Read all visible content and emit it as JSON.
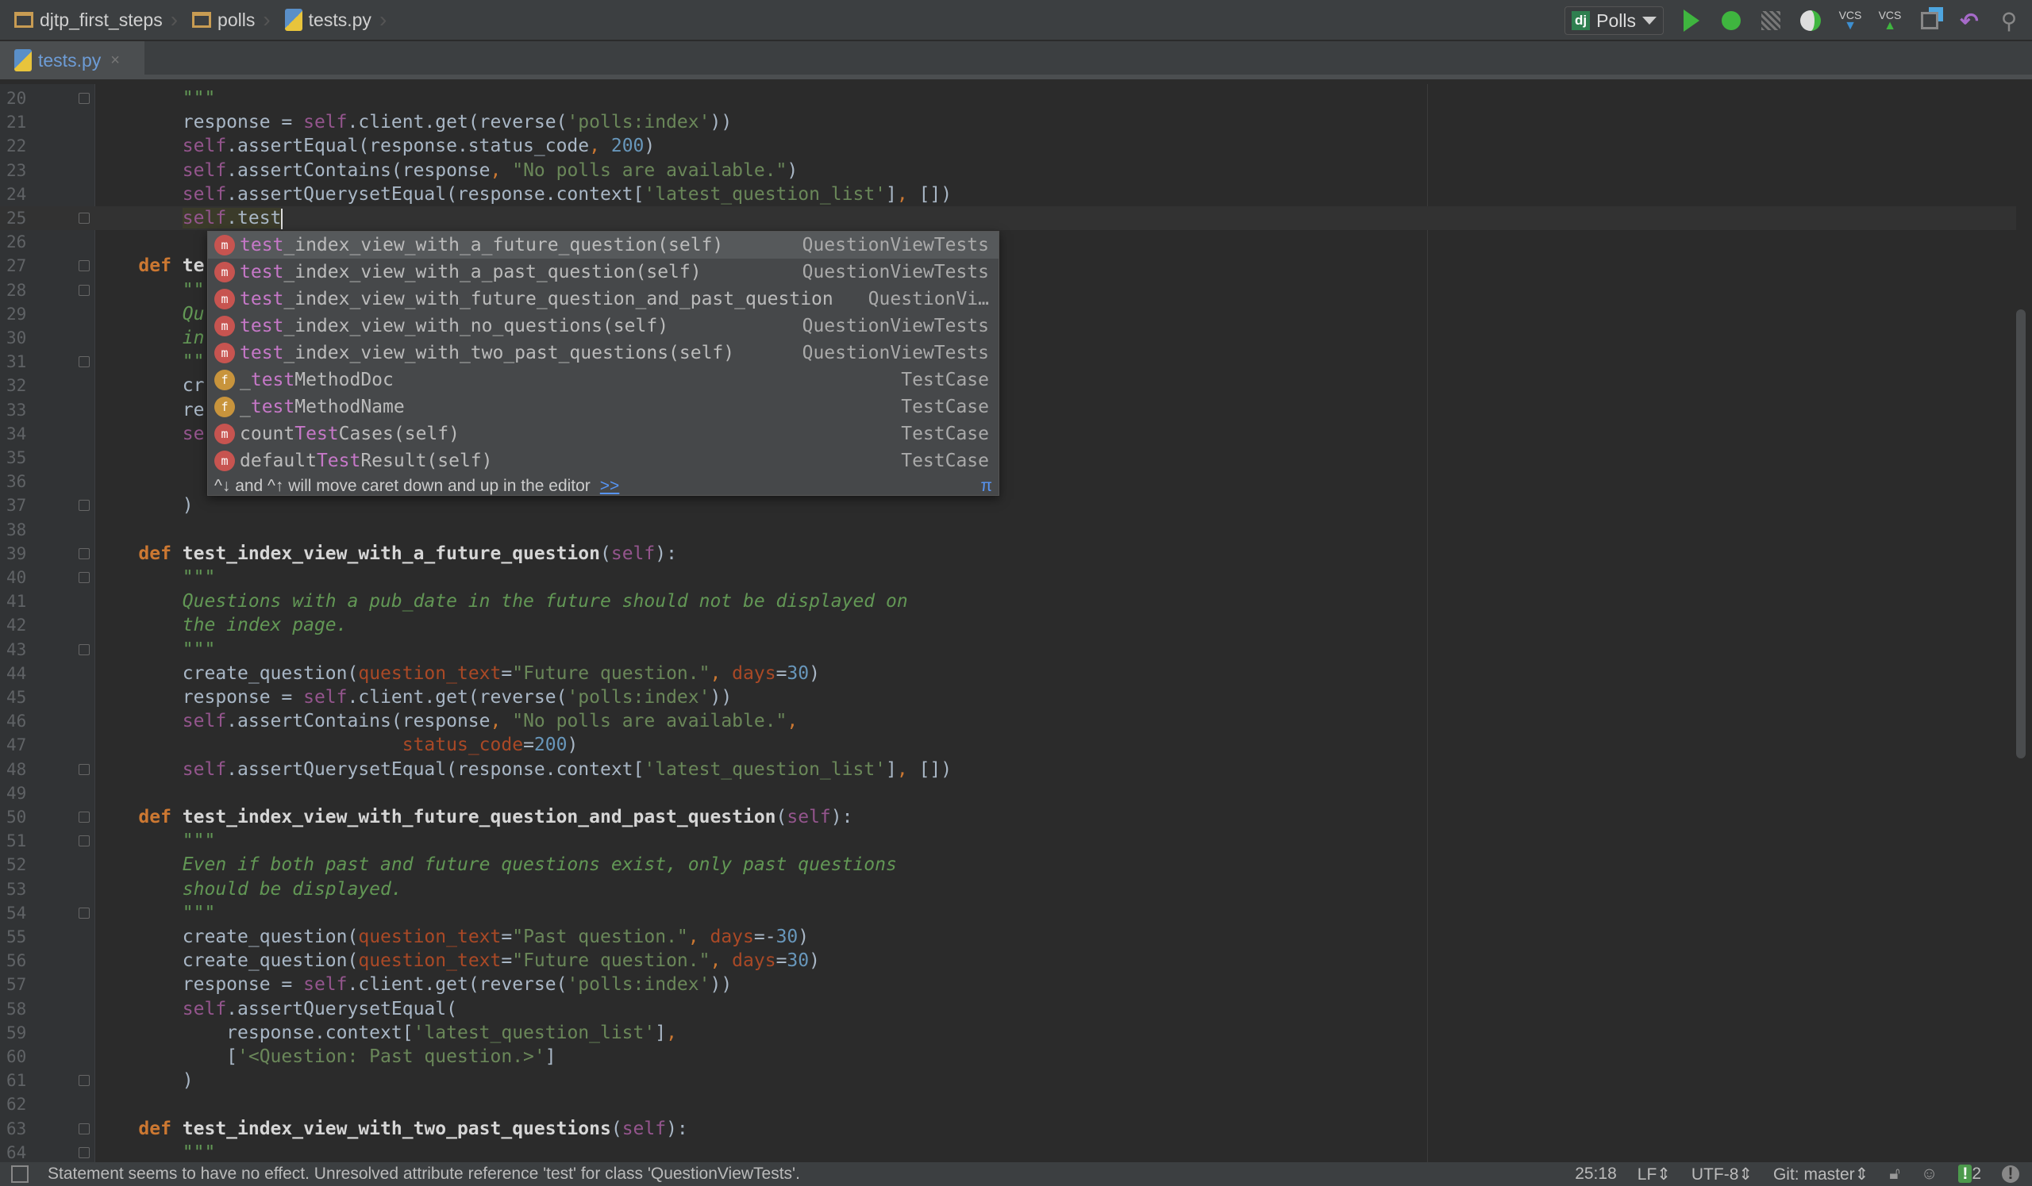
{
  "breadcrumb": [
    "djtp_first_steps",
    "polls",
    "tests.py"
  ],
  "run_config": {
    "label": "Polls",
    "badge": "dj"
  },
  "toolbar": {
    "vcs_update": "VCS",
    "vcs_commit": "VCS",
    "icons": [
      "run-icon",
      "debug-icon",
      "coverage-icon",
      "profile-icon",
      "vcs-update-icon",
      "vcs-commit-icon",
      "history-icon",
      "revert-icon",
      "search-icon"
    ]
  },
  "tab": {
    "label": "tests.py",
    "close": "×"
  },
  "colors": {
    "background": "#2b2b2b",
    "keyword": "#cc7832",
    "self": "#94558d",
    "string": "#6a8759",
    "number": "#6897bb",
    "docstring": "#629755",
    "kwarg": "#aa4926"
  },
  "code_lines": [
    {
      "n": "20",
      "t": [
        [
          "dq",
          "        \"\"\""
        ]
      ]
    },
    {
      "n": "21",
      "t": [
        [
          "p",
          "        response = "
        ],
        [
          "s",
          "self"
        ],
        [
          "p",
          ".client.get(reverse("
        ],
        [
          "str",
          "'polls:index'"
        ],
        [
          "p",
          "))"
        ]
      ]
    },
    {
      "n": "22",
      "t": [
        [
          "s",
          "        self"
        ],
        [
          "p",
          ".assertEqual(response.status_code"
        ],
        [
          "c",
          ", "
        ],
        [
          "n",
          "200"
        ],
        [
          "p",
          ")"
        ]
      ]
    },
    {
      "n": "23",
      "t": [
        [
          "s",
          "        self"
        ],
        [
          "p",
          ".assertContains(response"
        ],
        [
          "c",
          ", "
        ],
        [
          "str",
          "\"No polls are available.\""
        ],
        [
          "p",
          ")"
        ]
      ]
    },
    {
      "n": "24",
      "t": [
        [
          "s",
          "        self"
        ],
        [
          "p",
          ".assertQuerysetEqual(response.context["
        ],
        [
          "str",
          "'latest_question_list'"
        ],
        [
          "p",
          "]"
        ],
        [
          "c",
          ", "
        ],
        [
          "p",
          "[])"
        ]
      ]
    },
    {
      "n": "25",
      "t": [
        [
          "p",
          "        "
        ],
        [
          "s hl",
          "self"
        ],
        [
          "p hl",
          ".test"
        ]
      ],
      "cur": true
    },
    {
      "n": "26",
      "t": []
    },
    {
      "n": "27",
      "t": [
        [
          "k",
          "    def "
        ],
        [
          "fn",
          "te"
        ]
      ]
    },
    {
      "n": "28",
      "t": [
        [
          "dq",
          "        \"\"\""
        ]
      ]
    },
    {
      "n": "29",
      "t": [
        [
          "d",
          "        Qu"
        ]
      ]
    },
    {
      "n": "30",
      "t": [
        [
          "d",
          "        in"
        ]
      ]
    },
    {
      "n": "31",
      "t": [
        [
          "dq",
          "        \"\"\""
        ]
      ]
    },
    {
      "n": "32",
      "t": [
        [
          "p",
          "        cr"
        ]
      ]
    },
    {
      "n": "33",
      "t": [
        [
          "p",
          "        re"
        ]
      ]
    },
    {
      "n": "34",
      "t": [
        [
          "s",
          "        se"
        ]
      ]
    },
    {
      "n": "35",
      "t": []
    },
    {
      "n": "36",
      "t": []
    },
    {
      "n": "37",
      "t": [
        [
          "p",
          "        )"
        ]
      ]
    },
    {
      "n": "38",
      "t": []
    },
    {
      "n": "39",
      "t": [
        [
          "k",
          "    def "
        ],
        [
          "fn",
          "test_index_view_with_a_future_question"
        ],
        [
          "p",
          "("
        ],
        [
          "s",
          "self"
        ],
        [
          "p",
          "):"
        ]
      ]
    },
    {
      "n": "40",
      "t": [
        [
          "dq",
          "        \"\"\""
        ]
      ]
    },
    {
      "n": "41",
      "t": [
        [
          "d",
          "        Questions with a pub_date in the future should not be displayed on"
        ]
      ]
    },
    {
      "n": "42",
      "t": [
        [
          "d",
          "        the index page."
        ]
      ]
    },
    {
      "n": "43",
      "t": [
        [
          "dq",
          "        \"\"\""
        ]
      ]
    },
    {
      "n": "44",
      "t": [
        [
          "p",
          "        create_question("
        ],
        [
          "kw",
          "question_text"
        ],
        [
          "p",
          "="
        ],
        [
          "str",
          "\"Future question.\""
        ],
        [
          "c",
          ", "
        ],
        [
          "kw",
          "days"
        ],
        [
          "p",
          "="
        ],
        [
          "n",
          "30"
        ],
        [
          "p",
          ")"
        ]
      ]
    },
    {
      "n": "45",
      "t": [
        [
          "p",
          "        response = "
        ],
        [
          "s",
          "self"
        ],
        [
          "p",
          ".client.get(reverse("
        ],
        [
          "str",
          "'polls:index'"
        ],
        [
          "p",
          "))"
        ]
      ]
    },
    {
      "n": "46",
      "t": [
        [
          "s",
          "        self"
        ],
        [
          "p",
          ".assertContains(response"
        ],
        [
          "c",
          ", "
        ],
        [
          "str",
          "\"No polls are available.\""
        ],
        [
          "c",
          ","
        ]
      ]
    },
    {
      "n": "47",
      "t": [
        [
          "p",
          "                            "
        ],
        [
          "kw",
          "status_code"
        ],
        [
          "p",
          "="
        ],
        [
          "n",
          "200"
        ],
        [
          "p",
          ")"
        ]
      ]
    },
    {
      "n": "48",
      "t": [
        [
          "s",
          "        self"
        ],
        [
          "p",
          ".assertQuerysetEqual(response.context["
        ],
        [
          "str",
          "'latest_question_list'"
        ],
        [
          "p",
          "]"
        ],
        [
          "c",
          ", "
        ],
        [
          "p",
          "[])"
        ]
      ]
    },
    {
      "n": "49",
      "t": []
    },
    {
      "n": "50",
      "t": [
        [
          "k",
          "    def "
        ],
        [
          "fn",
          "test_index_view_with_future_question_and_past_question"
        ],
        [
          "p",
          "("
        ],
        [
          "s",
          "self"
        ],
        [
          "p",
          "):"
        ]
      ]
    },
    {
      "n": "51",
      "t": [
        [
          "dq",
          "        \"\"\""
        ]
      ]
    },
    {
      "n": "52",
      "t": [
        [
          "d",
          "        Even if both past and future questions exist, only past questions"
        ]
      ]
    },
    {
      "n": "53",
      "t": [
        [
          "d",
          "        should be displayed."
        ]
      ]
    },
    {
      "n": "54",
      "t": [
        [
          "dq",
          "        \"\"\""
        ]
      ]
    },
    {
      "n": "55",
      "t": [
        [
          "p",
          "        create_question("
        ],
        [
          "kw",
          "question_text"
        ],
        [
          "p",
          "="
        ],
        [
          "str",
          "\"Past question.\""
        ],
        [
          "c",
          ", "
        ],
        [
          "kw",
          "days"
        ],
        [
          "p",
          "=-"
        ],
        [
          "n",
          "30"
        ],
        [
          "p",
          ")"
        ]
      ]
    },
    {
      "n": "56",
      "t": [
        [
          "p",
          "        create_question("
        ],
        [
          "kw",
          "question_text"
        ],
        [
          "p",
          "="
        ],
        [
          "str",
          "\"Future question.\""
        ],
        [
          "c",
          ", "
        ],
        [
          "kw",
          "days"
        ],
        [
          "p",
          "="
        ],
        [
          "n",
          "30"
        ],
        [
          "p",
          ")"
        ]
      ]
    },
    {
      "n": "57",
      "t": [
        [
          "p",
          "        response = "
        ],
        [
          "s",
          "self"
        ],
        [
          "p",
          ".client.get(reverse("
        ],
        [
          "str",
          "'polls:index'"
        ],
        [
          "p",
          "))"
        ]
      ]
    },
    {
      "n": "58",
      "t": [
        [
          "s",
          "        self"
        ],
        [
          "p",
          ".assertQuerysetEqual("
        ]
      ]
    },
    {
      "n": "59",
      "t": [
        [
          "p",
          "            response.context["
        ],
        [
          "str",
          "'latest_question_list'"
        ],
        [
          "p",
          "]"
        ],
        [
          "c",
          ","
        ]
      ]
    },
    {
      "n": "60",
      "t": [
        [
          "p",
          "            ["
        ],
        [
          "str",
          "'<Question: Past question.>'"
        ],
        [
          "p",
          "]"
        ]
      ]
    },
    {
      "n": "61",
      "t": [
        [
          "p",
          "        )"
        ]
      ]
    },
    {
      "n": "62",
      "t": []
    },
    {
      "n": "63",
      "t": [
        [
          "k",
          "    def "
        ],
        [
          "fn",
          "test_index_view_with_two_past_questions"
        ],
        [
          "p",
          "("
        ],
        [
          "s",
          "self"
        ],
        [
          "p",
          "):"
        ]
      ]
    },
    {
      "n": "64",
      "t": [
        [
          "dq",
          "        \"\"\""
        ]
      ]
    }
  ],
  "fold_lines": [
    "20",
    "25",
    "27",
    "28",
    "31",
    "37",
    "39",
    "40",
    "43",
    "48",
    "50",
    "51",
    "54",
    "61",
    "63",
    "64"
  ],
  "completion": {
    "items": [
      {
        "icon": "m",
        "match": "test",
        "rest": "_index_view_with_a_future_question(self)",
        "type": "QuestionViewTests",
        "selected": true
      },
      {
        "icon": "m",
        "match": "test",
        "rest": "_index_view_with_a_past_question(self)",
        "type": "QuestionViewTests"
      },
      {
        "icon": "m",
        "match": "test",
        "rest": "_index_view_with_future_question_and_past_question",
        "type": "QuestionVi…"
      },
      {
        "icon": "m",
        "match": "test",
        "rest": "_index_view_with_no_questions(self)",
        "type": "QuestionViewTests"
      },
      {
        "icon": "m",
        "match": "test",
        "rest": "_index_view_with_two_past_questions(self)",
        "type": "QuestionViewTests"
      },
      {
        "icon": "f",
        "pre": "_",
        "match": "test",
        "rest": "MethodDoc",
        "type": "TestCase"
      },
      {
        "icon": "f",
        "pre": "_",
        "match": "test",
        "rest": "MethodName",
        "type": "TestCase"
      },
      {
        "icon": "m",
        "pre": "count",
        "match": "Test",
        "rest": "Cases(self)",
        "type": "TestCase"
      },
      {
        "icon": "m",
        "pre": "default",
        "match": "Test",
        "rest": "Result(self)",
        "type": "TestCase"
      }
    ],
    "hint": "^↓ and ^↑ will move caret down and up in the editor",
    "hint_link": ">>",
    "pi": "π"
  },
  "status": {
    "message": "Statement seems to have no effect. Unresolved attribute reference 'test' for class 'QuestionViewTests'.",
    "position": "25:18",
    "line_sep": "LF⇕",
    "encoding": "UTF-8⇕",
    "vcs": "Git: master⇕",
    "events": "!",
    "events_count": "2"
  }
}
